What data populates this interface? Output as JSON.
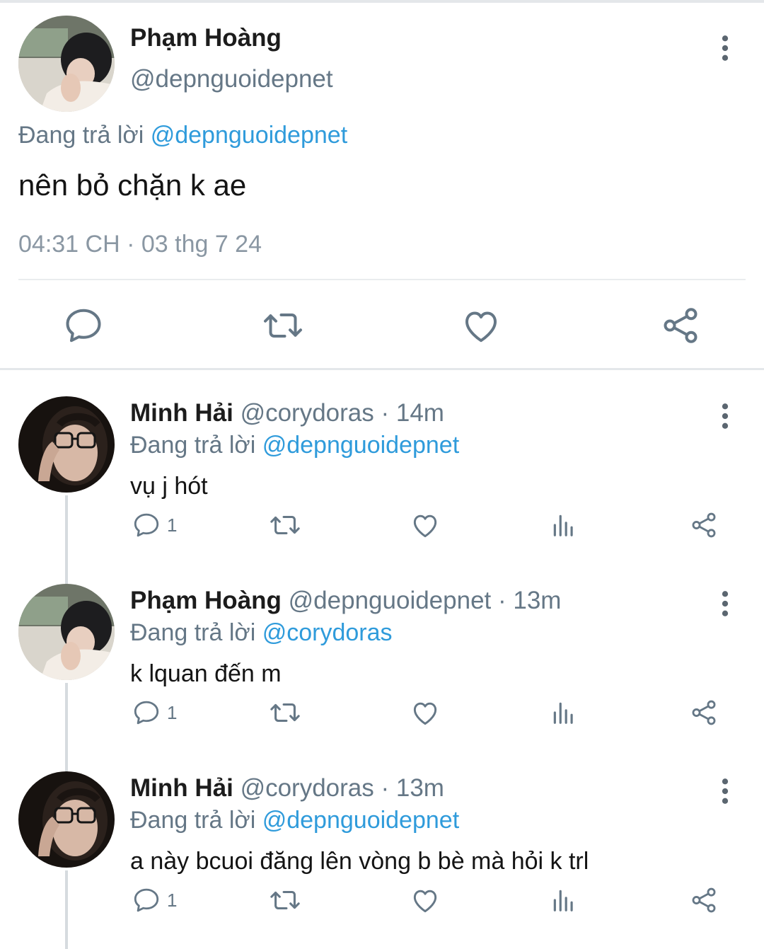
{
  "main_tweet": {
    "name": "Phạm Hoàng",
    "handle": "@depnguoidepnet",
    "replying_prefix": "Đang trả lời",
    "replying_to": "@depnguoidepnet",
    "text": "nên bỏ chặn k ae",
    "timestamp": "04:31 CH · 03 thg 7 24",
    "actions": [
      "reply-icon",
      "retweet-icon",
      "like-icon",
      "share-icon"
    ]
  },
  "replies": [
    {
      "name": "Minh Hải",
      "handle_time": "@corydoras · 14m",
      "replying_prefix": "Đang trả lời",
      "replying_to": "@depnguoidepnet",
      "text": "vụ j hót",
      "reply_count": "1"
    },
    {
      "name": "Phạm Hoàng",
      "handle_time": "@depnguoidepnet · 13m",
      "replying_prefix": "Đang trả lời",
      "replying_to": "@corydoras",
      "text": "k lquan đến m",
      "reply_count": "1"
    },
    {
      "name": "Minh Hải",
      "handle_time": "@corydoras · 13m",
      "replying_prefix": "Đang trả lời",
      "replying_to": "@depnguoidepnet",
      "text": "a này bcuoi đăng lên vòng b bè mà hỏi k trl",
      "reply_count": "1"
    }
  ],
  "colors": {
    "link": "#2f9bdb",
    "secondary_text": "#657786",
    "icon": "#657786"
  }
}
